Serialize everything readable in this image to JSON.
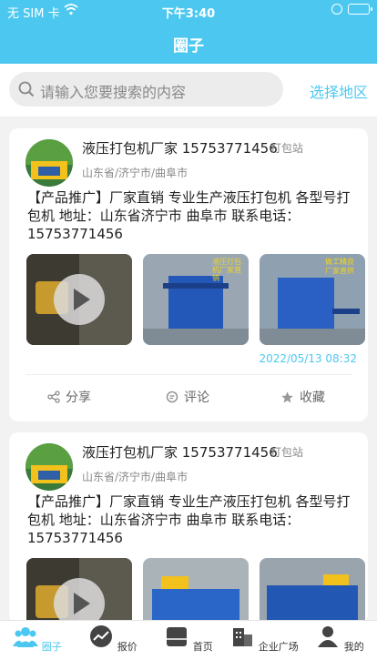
{
  "status_bar": {
    "carrier": "无 SIM 卡",
    "time": "下午3:40"
  },
  "header": {
    "title": "圈子"
  },
  "search": {
    "placeholder": "请输入您要搜索的内容",
    "region_label": "选择地区"
  },
  "posts": [
    {
      "name": "液压打包机厂家 15753771456",
      "tag": "打包站",
      "location": "山东省/济宁市/曲阜市",
      "content": "【产品推广】厂家直销  专业生产液压打包机  各型号打包机 地址：山东省济宁市 曲阜市 联系电话：15753771456",
      "image_captions": [
        "",
        "液压打包机厂家直销",
        "做工精良 厂家直供"
      ],
      "date": "2022/05/13 08:32",
      "actions": {
        "share": "分享",
        "comment": "评论",
        "favorite": "收藏"
      }
    },
    {
      "name": "液压打包机厂家 15753771456",
      "tag": "打包站",
      "location": "山东省/济宁市/曲阜市",
      "content": "【产品推广】厂家直销  专业生产液压打包机  各型号打包机 地址：山东省济宁市 曲阜市 联系电话：15753771456"
    }
  ],
  "tabbar": [
    {
      "label": "圈子",
      "icon": "people-icon",
      "active": true
    },
    {
      "label": "报价",
      "icon": "chart-icon",
      "active": false
    },
    {
      "label": "首页",
      "icon": "home-icon",
      "active": false
    },
    {
      "label": "企业广场",
      "icon": "building-icon",
      "active": false
    },
    {
      "label": "我的",
      "icon": "user-icon",
      "active": false
    }
  ],
  "colors": {
    "accent": "#4cc8f0",
    "background": "#f2f2f2"
  }
}
